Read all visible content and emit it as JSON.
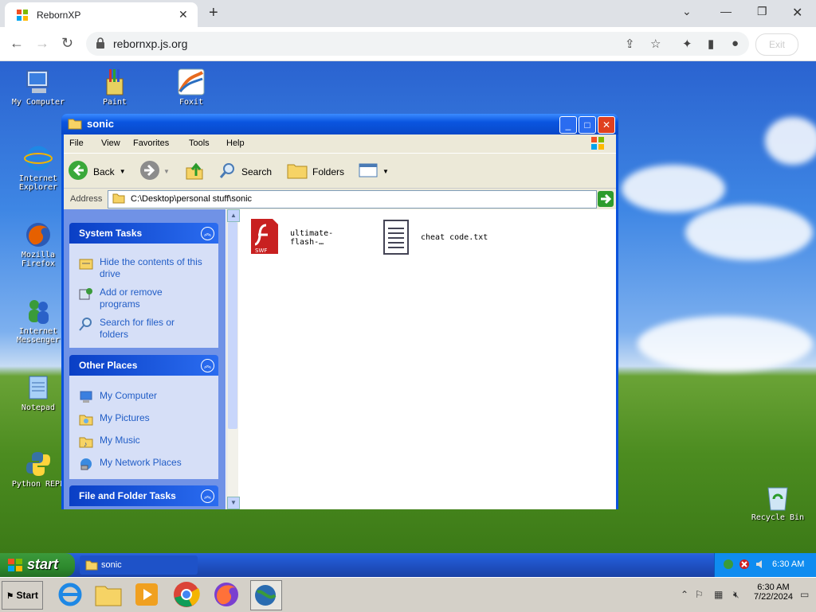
{
  "browser": {
    "tab_title": "RebornXP",
    "url": "rebornxp.js.org",
    "exit_label": "Exit"
  },
  "desktop": {
    "icons": [
      {
        "label": "My Computer"
      },
      {
        "label": "Paint"
      },
      {
        "label": "Foxit"
      },
      {
        "label_l1": "Internet",
        "label_l2": "Explorer"
      },
      {
        "label_l1": "Mozilla",
        "label_l2": "Firefox"
      },
      {
        "label_l1": "Internet",
        "label_l2": "Messenger"
      },
      {
        "label": "Notepad"
      },
      {
        "label": "Python REPL"
      },
      {
        "label": "Recycle Bin"
      }
    ]
  },
  "window": {
    "title": "sonic",
    "menu": [
      "File",
      "View",
      "Favorites",
      "Tools",
      "Help"
    ],
    "toolbar": {
      "back": "Back",
      "search": "Search",
      "folders": "Folders"
    },
    "address_label": "Address",
    "address": "C:\\Desktop\\personal stuff\\sonic",
    "panels": {
      "system_tasks": {
        "title": "System Tasks",
        "items": [
          {
            "l1": "Hide the contents of this",
            "l2": "drive"
          },
          {
            "l1": "Add or remove",
            "l2": "programs"
          },
          {
            "l1": "Search for files or",
            "l2": "folders"
          }
        ]
      },
      "other_places": {
        "title": "Other Places",
        "items": [
          "My Computer",
          "My Pictures",
          "My Music",
          "My Network Places"
        ]
      },
      "file_tasks": {
        "title": "File and Folder Tasks"
      }
    },
    "files": [
      {
        "l1": "ultimate-",
        "l2": "flash-…",
        "badge": "SWF"
      },
      {
        "l1": "cheat code.txt"
      }
    ]
  },
  "xp_taskbar": {
    "start": "start",
    "task": "sonic",
    "clock": "6:30 AM"
  },
  "host_taskbar": {
    "start": "Start",
    "time": "6:30 AM",
    "date": "7/22/2024"
  }
}
